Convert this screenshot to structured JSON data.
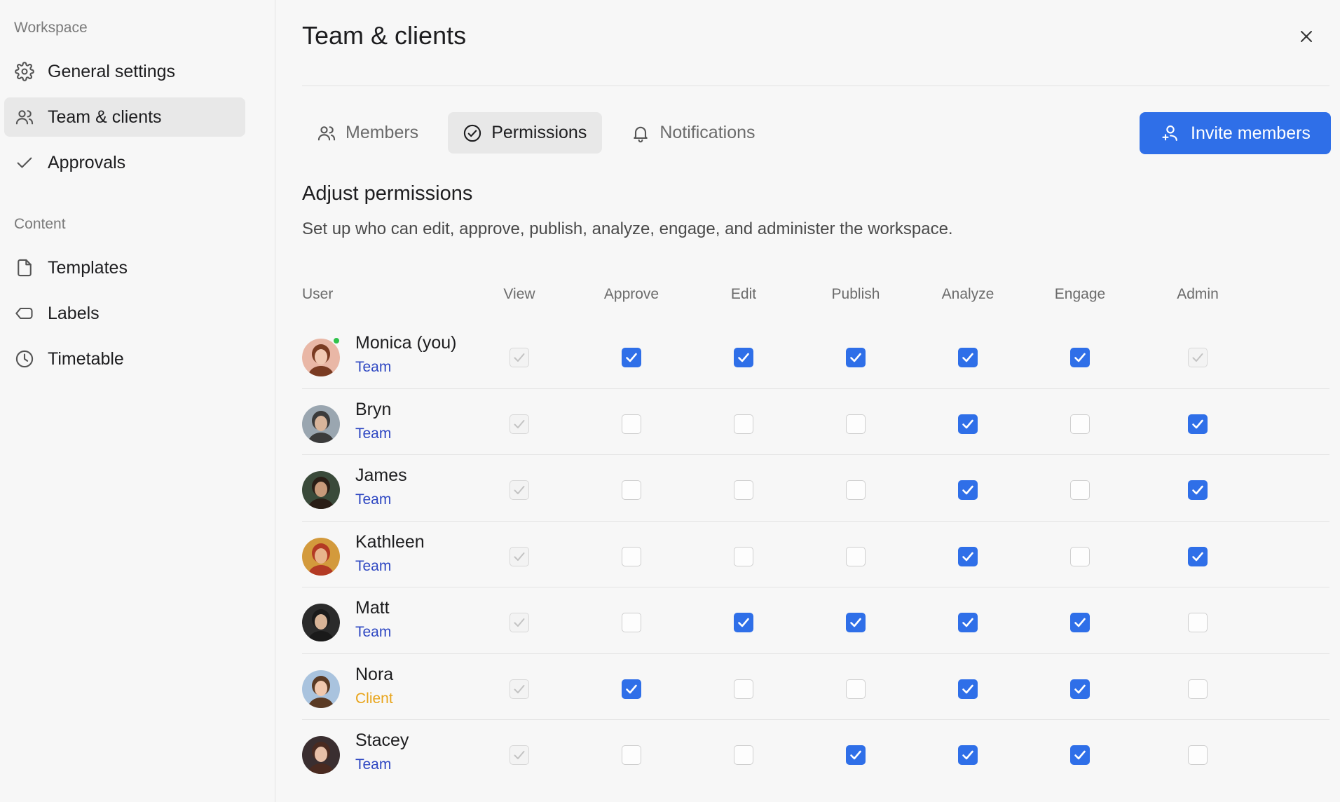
{
  "sidebar": {
    "workspace_label": "Workspace",
    "content_label": "Content",
    "items": [
      {
        "label": "General settings",
        "icon": "gear-icon"
      },
      {
        "label": "Team & clients",
        "icon": "users-icon",
        "active": true
      },
      {
        "label": "Approvals",
        "icon": "check-icon"
      },
      {
        "label": "Templates",
        "icon": "file-icon"
      },
      {
        "label": "Labels",
        "icon": "tag-icon"
      },
      {
        "label": "Timetable",
        "icon": "clock-icon"
      }
    ]
  },
  "header": {
    "title": "Team & clients",
    "close_icon": "close-icon"
  },
  "tabs": [
    {
      "label": "Members",
      "icon": "users-icon"
    },
    {
      "label": "Permissions",
      "icon": "check-circle-icon",
      "active": true
    },
    {
      "label": "Notifications",
      "icon": "bell-icon"
    }
  ],
  "invite_button": {
    "label": "Invite members",
    "icon": "user-plus-icon"
  },
  "permissions": {
    "title": "Adjust permissions",
    "description": "Set up who can edit, approve, publish, analyze, engage, and administer the workspace.",
    "columns": [
      "User",
      "View",
      "Approve",
      "Edit",
      "Publish",
      "Analyze",
      "Engage",
      "Admin"
    ],
    "rows": [
      {
        "name": "Monica (you)",
        "role": "Team",
        "online": true,
        "perms": [
          "disabled",
          "on",
          "on",
          "on",
          "on",
          "on",
          "disabled"
        ]
      },
      {
        "name": "Bryn",
        "role": "Team",
        "perms": [
          "disabled",
          "off",
          "off",
          "off",
          "on",
          "off",
          "on"
        ]
      },
      {
        "name": "James",
        "role": "Team",
        "perms": [
          "disabled",
          "off",
          "off",
          "off",
          "on",
          "off",
          "on"
        ]
      },
      {
        "name": "Kathleen",
        "role": "Team",
        "perms": [
          "disabled",
          "off",
          "off",
          "off",
          "on",
          "off",
          "on"
        ]
      },
      {
        "name": "Matt",
        "role": "Team",
        "perms": [
          "disabled",
          "off",
          "on",
          "on",
          "on",
          "on",
          "off"
        ]
      },
      {
        "name": "Nora",
        "role": "Client",
        "perms": [
          "disabled",
          "on",
          "off",
          "off",
          "on",
          "on",
          "off"
        ]
      },
      {
        "name": "Stacey",
        "role": "Team",
        "perms": [
          "disabled",
          "off",
          "off",
          "on",
          "on",
          "on",
          "off"
        ]
      }
    ]
  },
  "colors": {
    "accent": "#2f6fe8",
    "team_role": "#2e47c2",
    "client_role": "#e8a41a",
    "online": "#2fc24b"
  }
}
